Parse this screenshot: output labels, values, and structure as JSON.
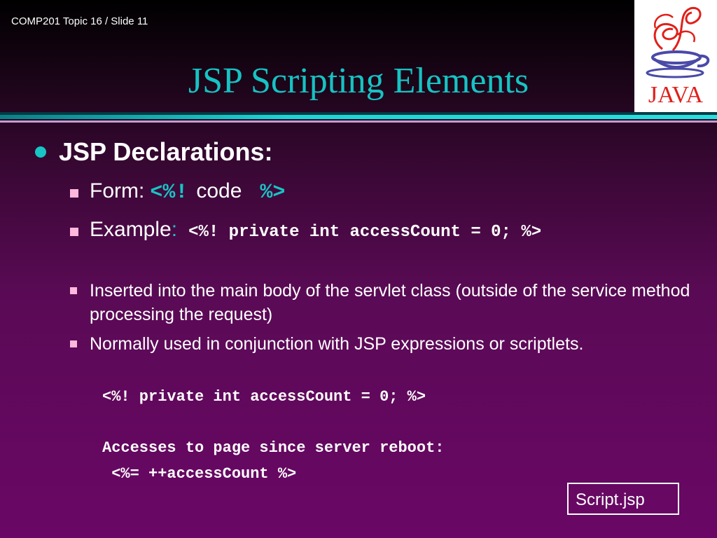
{
  "header": {
    "slide_label": "COMP201 Topic 16 / Slide 11",
    "title": "JSP Scripting Elements"
  },
  "logo": {
    "text": "JAVA",
    "icon": "java-coffee-cup-icon"
  },
  "colors": {
    "accent": "#17c5c5",
    "bullet_square": "#ffb7dd",
    "background": "#5a0a55"
  },
  "body": {
    "heading": "JSP Declarations:",
    "form_label": "Form:",
    "form_open": "<%!",
    "form_code": "code",
    "form_close": "%>",
    "example_label": "Example",
    "example_colon": ":",
    "example_code": "<%! private int accessCount = 0; %>",
    "points": [
      "Inserted into the main body of the servlet class (outside of the service method processing the request)",
      "Normally used in conjunction with JSP expressions or scriptlets."
    ],
    "code_lines": [
      "<%! private int accessCount = 0; %>",
      "Accesses to page since server reboot:",
      " <%= ++accessCount %>"
    ],
    "file_name": "Script.jsp"
  }
}
